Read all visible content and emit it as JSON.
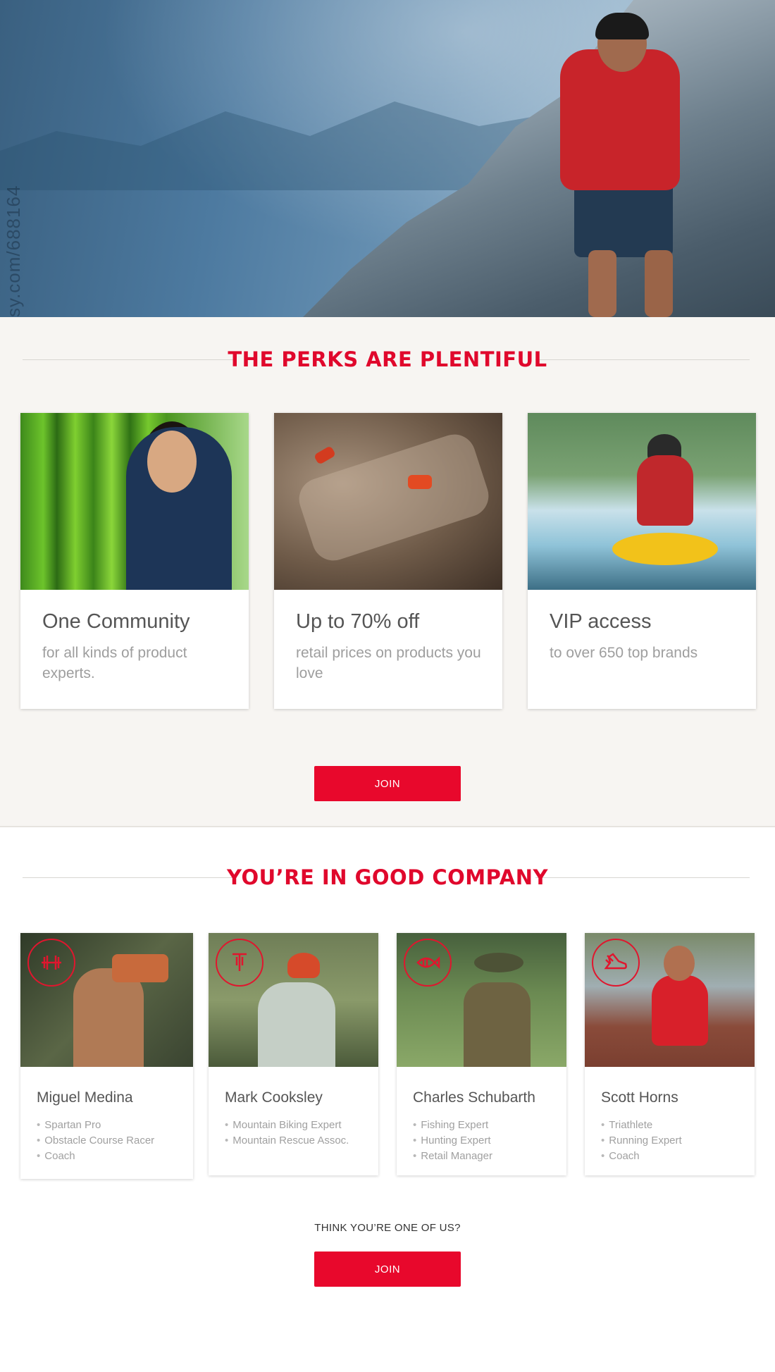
{
  "hero": {
    "watermark": "sy.com/688164"
  },
  "perks": {
    "heading": "THE PERKS ARE PLENTIFUL",
    "cards": [
      {
        "title": "One Community",
        "desc": "for all kinds of product experts."
      },
      {
        "title": "Up to 70% off",
        "desc": "retail prices on products you love"
      },
      {
        "title": "VIP access",
        "desc": "to over 650 top brands"
      }
    ],
    "join_label": "JOIN"
  },
  "company": {
    "heading": "YOU’RE IN GOOD COMPANY",
    "experts": [
      {
        "name": "Miguel Medina",
        "icon": "dumbbell-icon",
        "roles": [
          "Spartan Pro",
          "Obstacle Course Racer",
          "Coach"
        ]
      },
      {
        "name": "Mark Cooksley",
        "icon": "bike-icon",
        "roles": [
          "Mountain Biking Expert",
          "Mountain Rescue Assoc."
        ]
      },
      {
        "name": "Charles Schubarth",
        "icon": "fish-icon",
        "roles": [
          "Fishing Expert",
          "Hunting Expert",
          "Retail Manager"
        ]
      },
      {
        "name": "Scott Horns",
        "icon": "running-shoe-icon",
        "roles": [
          "Triathlete",
          "Running Expert",
          "Coach"
        ]
      }
    ],
    "prompt": "THINK YOU’RE ONE OF US?",
    "join_label": "JOIN"
  },
  "colors": {
    "accent": "#e8082c",
    "background_alt": "#f7f5f2"
  }
}
